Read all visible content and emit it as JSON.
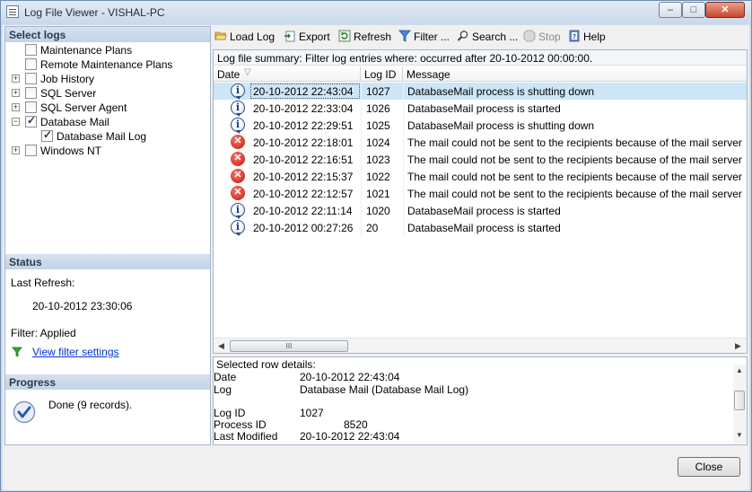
{
  "window": {
    "title": "Log File Viewer - VISHAL-PC",
    "minimize": "–",
    "maximize": "□",
    "close": "✕"
  },
  "select_logs": {
    "header": "Select logs",
    "items": [
      {
        "label": "Maintenance Plans",
        "checked": false,
        "expander": ""
      },
      {
        "label": "Remote Maintenance Plans",
        "checked": false,
        "expander": ""
      },
      {
        "label": "Job History",
        "checked": false,
        "expander": "+"
      },
      {
        "label": "SQL Server",
        "checked": false,
        "expander": "+"
      },
      {
        "label": "SQL Server Agent",
        "checked": false,
        "expander": "+"
      },
      {
        "label": "Database Mail",
        "checked": true,
        "expander": "−"
      },
      {
        "label": "Database Mail Log",
        "checked": true,
        "expander": ""
      },
      {
        "label": "Windows NT",
        "checked": false,
        "expander": "+"
      }
    ]
  },
  "status": {
    "header": "Status",
    "last_refresh_label": "Last Refresh:",
    "last_refresh_value": "20-10-2012 23:30:06",
    "filter_label": "Filter: Applied",
    "filter_link": "View filter settings"
  },
  "progress": {
    "header": "Progress",
    "text": "Done (9 records)."
  },
  "toolbar": {
    "load_log": "Load Log",
    "export": "Export",
    "refresh": "Refresh",
    "filter": "Filter ...",
    "search": "Search ...",
    "stop": "Stop",
    "help": "Help"
  },
  "grid": {
    "summary": "Log file summary: Filter log entries where: occurred after 20-10-2012 00:00:00.",
    "columns": {
      "date": "Date",
      "sort_glyph": "▽",
      "log_id": "Log ID",
      "message": "Message"
    },
    "rows": [
      {
        "type": "info",
        "date": "20-10-2012 22:43:04",
        "log_id": "1027",
        "message": "DatabaseMail process is shutting down"
      },
      {
        "type": "info",
        "date": "20-10-2012 22:33:04",
        "log_id": "1026",
        "message": "DatabaseMail process is started"
      },
      {
        "type": "info",
        "date": "20-10-2012 22:29:51",
        "log_id": "1025",
        "message": "DatabaseMail process is shutting down"
      },
      {
        "type": "error",
        "date": "20-10-2012 22:18:01",
        "log_id": "1024",
        "message": "The mail could not be sent to the recipients because of the mail server failure. (S"
      },
      {
        "type": "error",
        "date": "20-10-2012 22:16:51",
        "log_id": "1023",
        "message": "The mail could not be sent to the recipients because of the mail server failure. (S"
      },
      {
        "type": "error",
        "date": "20-10-2012 22:15:37",
        "log_id": "1022",
        "message": "The mail could not be sent to the recipients because of the mail server failure. (S"
      },
      {
        "type": "error",
        "date": "20-10-2012 22:12:57",
        "log_id": "1021",
        "message": "The mail could not be sent to the recipients because of the mail server failure. (S"
      },
      {
        "type": "info",
        "date": "20-10-2012 22:11:14",
        "log_id": "1020",
        "message": "DatabaseMail process is started"
      },
      {
        "type": "info",
        "date": "20-10-2012 00:27:26",
        "log_id": "20",
        "message": "DatabaseMail process is started"
      }
    ],
    "scroll_grip": "III"
  },
  "details": {
    "header": "Selected row details:",
    "date_label": "Date",
    "date_value": "20-10-2012 22:43:04",
    "log_label": "Log",
    "log_value": "Database Mail (Database Mail Log)",
    "log_id_label": "Log ID",
    "log_id_value": "1027",
    "process_id_label": "Process ID",
    "process_id_value": "8520",
    "last_modified_label": "Last Modified",
    "last_modified_value": "20-10-2012 22:43:04"
  },
  "footer": {
    "close_label": "Close"
  },
  "colors": {
    "selected_row": "#cde6f7",
    "panel_header": "#c3d3e6",
    "error": "#c8120a",
    "info": "#2a4a8a",
    "link": "#0033cc"
  }
}
